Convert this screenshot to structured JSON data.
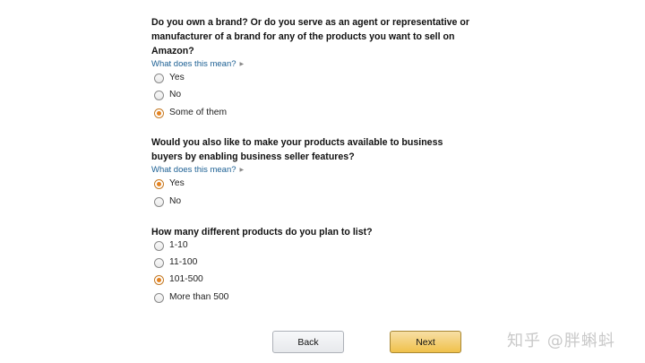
{
  "questions": [
    {
      "title": "Do you own a brand? Or do you serve as an agent or representative or manufacturer of a brand for any of the products you want to sell on Amazon?",
      "help": "What does this mean?",
      "options": [
        "Yes",
        "No",
        "Some of them"
      ],
      "selected": "Some of them"
    },
    {
      "title": "Would you also like to make your products available to business buyers by enabling business seller features?",
      "help": "What does this mean?",
      "options": [
        "Yes",
        "No"
      ],
      "selected": "Yes"
    },
    {
      "title": "How many different products do you plan to list?",
      "options": [
        "1-10",
        "11-100",
        "101-500",
        "More than 500"
      ],
      "selected": "101-500"
    }
  ],
  "buttons": {
    "back": "Back",
    "next": "Next"
  },
  "watermark": "知乎 @胖蝌蚪",
  "colors": {
    "accent": "#e4821f",
    "link": "#1b5f93",
    "next_button": "#f0c14b"
  },
  "icons": {
    "help_caret": "caret-right-icon"
  }
}
